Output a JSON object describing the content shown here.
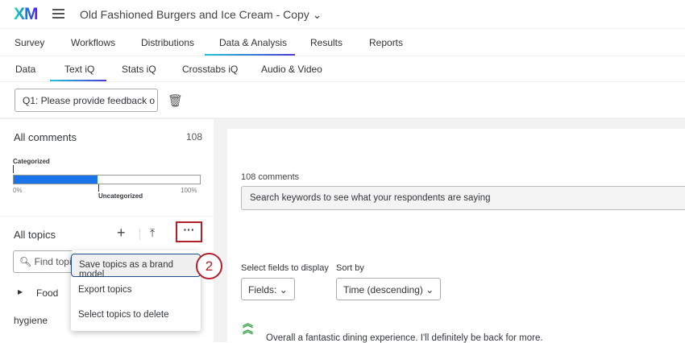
{
  "header": {
    "logo": "XM",
    "title": "Old Fashioned Burgers and Ice Cream - Copy"
  },
  "tabs": [
    "Survey",
    "Workflows",
    "Distributions",
    "Data & Analysis",
    "Results",
    "Reports"
  ],
  "subtabs": [
    "Data",
    "Text iQ",
    "Stats iQ",
    "Crosstabs iQ",
    "Audio & Video"
  ],
  "question_select": "Q1: Please provide feedback o",
  "left": {
    "all_comments": "All comments",
    "count": "108",
    "categorized": "Categorized",
    "uncategorized": "Uncategorized",
    "pct_min": "0%",
    "pct_max": "100%",
    "categorized_fraction": 0.45,
    "all_topics": "All topics",
    "find_placeholder": "Find topi",
    "topics": [
      "Food",
      "hygiene"
    ]
  },
  "menu": {
    "items": [
      "Save topics as a brand model",
      "Export topics",
      "Select topics to delete"
    ],
    "step": "2"
  },
  "right": {
    "comments_count": "108 comments",
    "search_placeholder": "Search keywords to see what your respondents are saying",
    "fields_label": "Select fields to display",
    "fields_value": "Fields:",
    "sort_label": "Sort by",
    "sort_value": "Time (descending)",
    "comment": "Overall a fantastic dining experience. I'll definitely be back for more."
  },
  "colors": {
    "accent": "#1a73e8",
    "highlight": "#b0202a",
    "positive": "#2e9e3e"
  }
}
